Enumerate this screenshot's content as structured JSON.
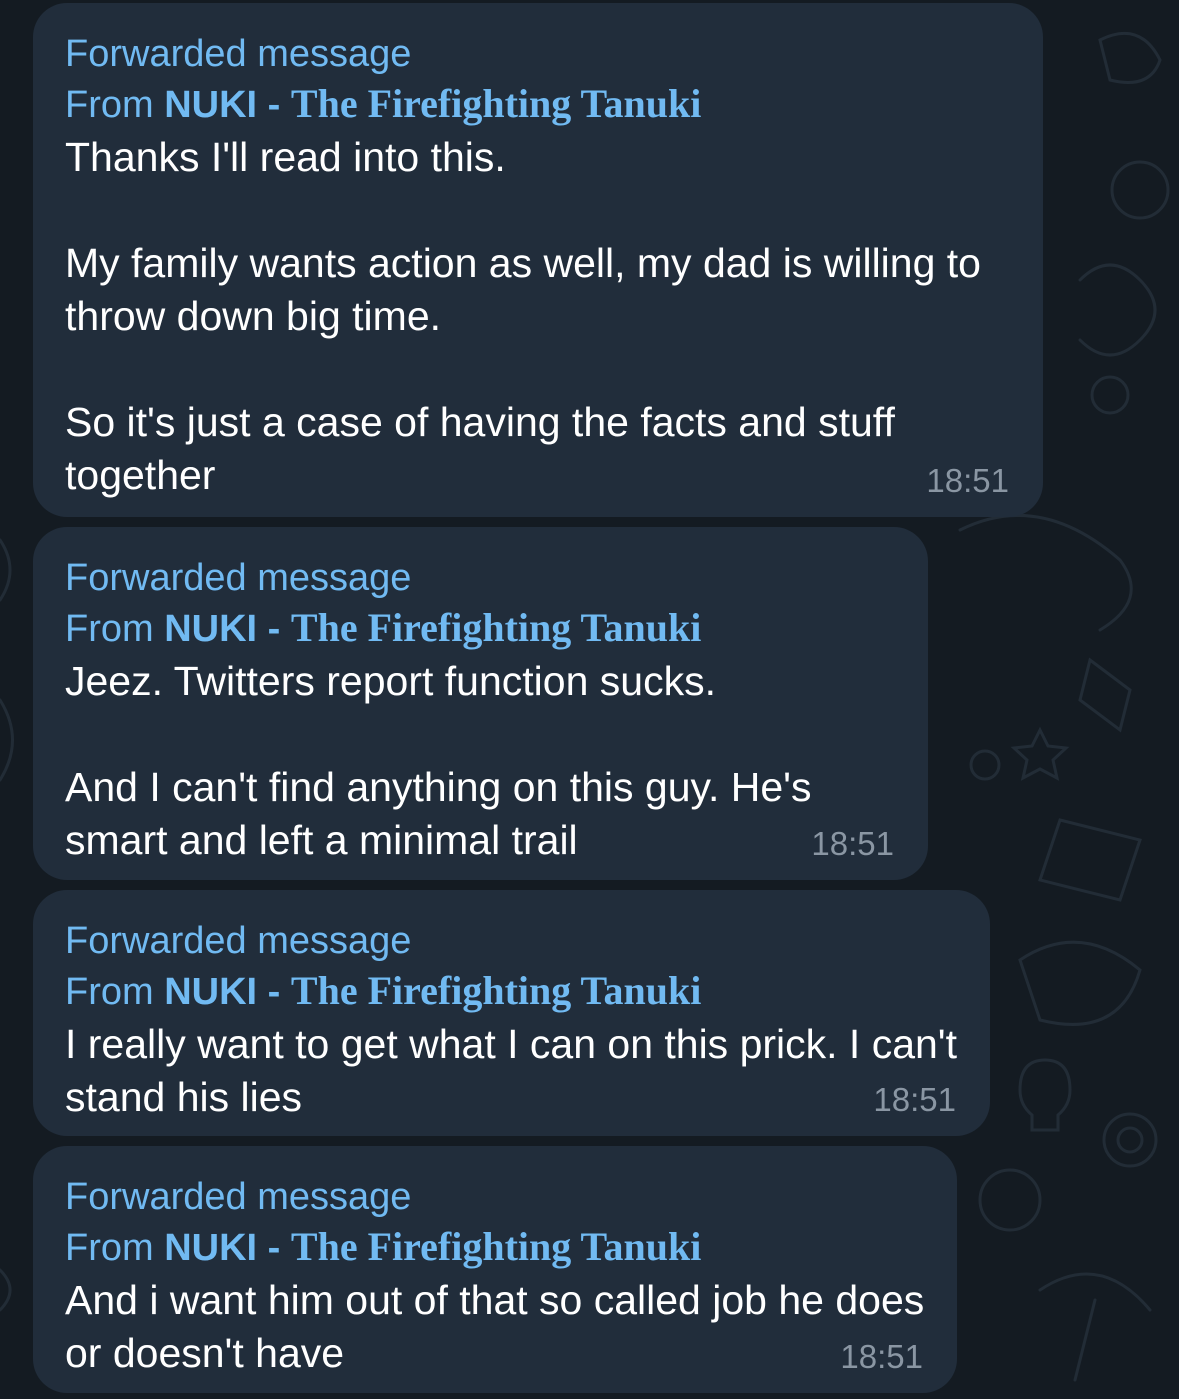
{
  "chat": {
    "messages": [
      {
        "forward_label": "Forwarded message",
        "from_prefix": "From",
        "sender_short": "NUKI",
        "sender_sep": " - ",
        "sender_channel": "The Firefighting Tanuki",
        "text": "Thanks I'll read into this.\n\nMy family wants action as well, my dad is willing to throw down big time.\n\nSo it's just a case of having the facts and stuff together",
        "time": "18:51"
      },
      {
        "forward_label": "Forwarded message",
        "from_prefix": "From",
        "sender_short": "NUKI",
        "sender_sep": " - ",
        "sender_channel": "The Firefighting Tanuki",
        "text": "Jeez. Twitters report function sucks.\n\nAnd I can't find anything on this guy. He's smart and left a minimal trail",
        "time": "18:51"
      },
      {
        "forward_label": "Forwarded message",
        "from_prefix": "From",
        "sender_short": "NUKI",
        "sender_sep": " - ",
        "sender_channel": "The Firefighting Tanuki",
        "text": "I really want to get what I can on this prick. I can't stand his lies",
        "time": "18:51"
      },
      {
        "forward_label": "Forwarded message",
        "from_prefix": "From",
        "sender_short": "NUKI",
        "sender_sep": " - ",
        "sender_channel": "The Firefighting Tanuki",
        "text": "And i want him out of that so called job he does or doesn't have",
        "time": "18:51"
      }
    ]
  },
  "theme": {
    "background": "#141b22",
    "bubble": "#212d3b",
    "link": "#71baf2",
    "time": "#8a96a3"
  }
}
